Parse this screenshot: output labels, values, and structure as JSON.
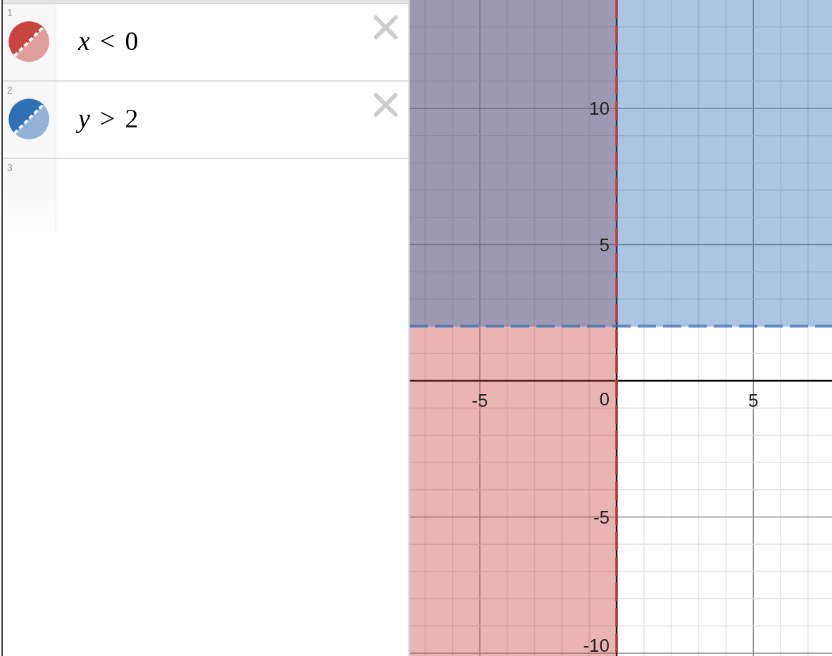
{
  "expressions": [
    {
      "number": "1",
      "text": "*x* < 0",
      "color": "#c74440",
      "kind": "vertical"
    },
    {
      "number": "2",
      "text": "*y* > 2",
      "color": "#2d70b3",
      "kind": "horizontal"
    },
    {
      "number": "3",
      "kind": "blank"
    }
  ],
  "graph": {
    "x_tick_labels": [
      "-5",
      "0",
      "5"
    ],
    "y_tick_labels": [
      "10",
      "5",
      "-5",
      "-10"
    ]
  }
}
